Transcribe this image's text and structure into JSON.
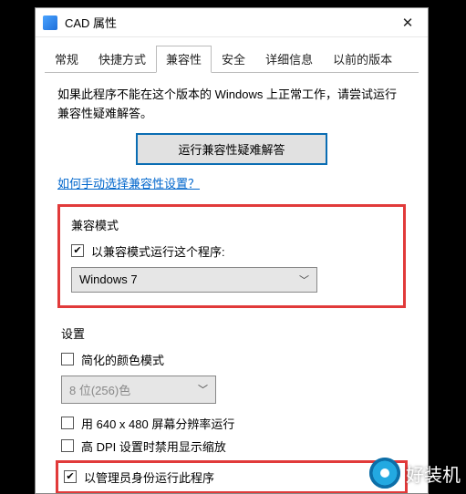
{
  "window": {
    "title": "CAD 属性"
  },
  "tabs": [
    "常规",
    "快捷方式",
    "兼容性",
    "安全",
    "详细信息",
    "以前的版本"
  ],
  "activeTabIndex": 2,
  "intro": "如果此程序不能在这个版本的 Windows 上正常工作，请尝试运行兼容性疑难解答。",
  "troubleshootBtn": "运行兼容性疑难解答",
  "manualLink": "如何手动选择兼容性设置？",
  "compat": {
    "groupTitle": "兼容模式",
    "checkboxLabel": "以兼容模式运行这个程序:",
    "checked": true,
    "selected": "Windows 7"
  },
  "settings": {
    "groupTitle": "设置",
    "reducedColor": {
      "label": "简化的颜色模式",
      "checked": false
    },
    "colorDepth": "8 位(256)色",
    "res640": {
      "label": "用 640 x 480 屏幕分辨率运行",
      "checked": false
    },
    "disableDpiScaling": {
      "label": "高 DPI 设置时禁用显示缩放",
      "checked": false
    },
    "runAsAdmin": {
      "label": "以管理员身份运行此程序",
      "checked": true
    }
  },
  "watermark": "好装机"
}
